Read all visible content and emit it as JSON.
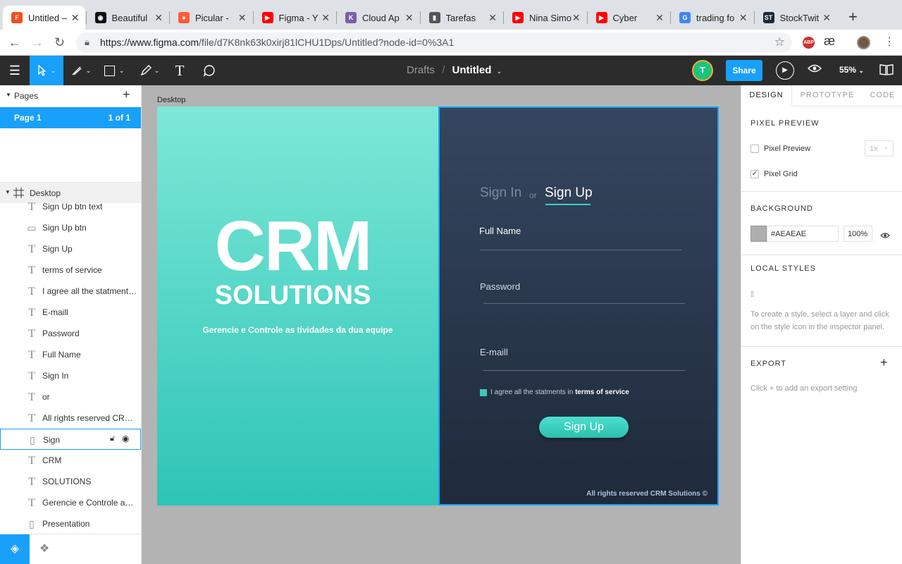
{
  "browser": {
    "tabs": [
      {
        "title": "Untitled –",
        "color": "#f24e1e",
        "glyph": "F"
      },
      {
        "title": "Beautiful",
        "color": "#111111",
        "glyph": "◉"
      },
      {
        "title": "Picular - ",
        "color": "#ff5a36",
        "glyph": "●"
      },
      {
        "title": "Figma - Y",
        "color": "#ff0000",
        "glyph": "▶"
      },
      {
        "title": "Cloud Ap",
        "color": "#7b5ea7",
        "glyph": "K"
      },
      {
        "title": "Tarefas",
        "color": "#555555",
        "glyph": "▮"
      },
      {
        "title": "Nina Simo",
        "color": "#ff0000",
        "glyph": "▶"
      },
      {
        "title": "Cyber",
        "color": "#ff0000",
        "glyph": "▶"
      },
      {
        "title": "trading fo",
        "color": "#4285f4",
        "glyph": "G"
      },
      {
        "title": "StockTwit",
        "color": "#1a2a3a",
        "glyph": "ST"
      }
    ],
    "url_host": "https://www.figma.com",
    "url_path": "/file/d7K8nk63k0xirj81lCHU1Dps/Untitled?node-id=0%3A1",
    "ext_abp": "ABP",
    "ext_ae": "æ"
  },
  "figma": {
    "breadcrumb_parent": "Drafts",
    "breadcrumb_sep": "/",
    "file_title": "Untitled",
    "avatar_letter": "T",
    "share_label": "Share",
    "zoom": "55%",
    "pages_header": "Pages",
    "page_name": "Page 1",
    "page_count": "1 of 1",
    "frame_name": "Desktop",
    "layers": [
      {
        "name": "Sign Up btn text",
        "icon": "T"
      },
      {
        "name": "Sign Up btn",
        "icon": "▭"
      },
      {
        "name": "Sign Up",
        "icon": "T"
      },
      {
        "name": "terms of service",
        "icon": "T"
      },
      {
        "name": "I agree all the statments in",
        "icon": "T"
      },
      {
        "name": "E-maill",
        "icon": "T"
      },
      {
        "name": "Password",
        "icon": "T"
      },
      {
        "name": "Full Name",
        "icon": "T"
      },
      {
        "name": "Sign In",
        "icon": "T"
      },
      {
        "name": "or",
        "icon": "T"
      },
      {
        "name": "All rights reserved CRM S...",
        "icon": "T"
      },
      {
        "name": "Sign",
        "icon": "▯"
      },
      {
        "name": "CRM",
        "icon": "T"
      },
      {
        "name": "SOLUTIONS",
        "icon": "T"
      },
      {
        "name": "Gerencie e Controle as tiv...",
        "icon": "T"
      },
      {
        "name": "Presentation",
        "icon": "▯"
      }
    ],
    "right_tabs": [
      "DESIGN",
      "PROTOTYPE",
      "CODE"
    ],
    "pixel_preview_title": "PIXEL PREVIEW",
    "pixel_preview_label": "Pixel Preview",
    "pixel_preview_scale": "1x",
    "pixel_grid_label": "Pixel Grid",
    "background_title": "BACKGROUND",
    "bg_hex": "#AEAEAE",
    "bg_opacity": "100%",
    "local_styles_title": "LOCAL STYLES",
    "local_styles_hint": "To create a style, select a layer and click on the style icon in the inspector panel.",
    "export_title": "EXPORT",
    "export_hint": "Click + to add an export setting",
    "help": "?"
  },
  "design": {
    "crm": "CRM",
    "solutions": "SOLUTIONS",
    "tagline": "Gerencie e Controle as tividades da dua equipe",
    "sign_in": "Sign In",
    "or": "or",
    "sign_up": "Sign Up",
    "full_name": "Full Name",
    "password": "Password",
    "email": "E-maill",
    "agree": "I agree all the statments in",
    "terms": "terms of service",
    "button": "Sign Up",
    "footer": "All rights reserved CRM Solutions ©"
  },
  "colors": {
    "accent": "#18a0fb",
    "teal_top": "#7de8d8",
    "teal_bottom": "#2ec4b6",
    "navy_top": "#34465f",
    "navy_bottom": "#1f2a3b"
  }
}
